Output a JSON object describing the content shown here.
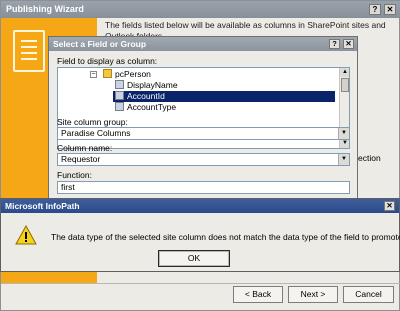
{
  "wizard": {
    "title": "Publishing Wizard",
    "intro": "The fields listed below will be available as columns in SharePoint sites and Outlook folders.",
    "behind_text": "ection",
    "back_label": "< Back",
    "next_label": "Next >",
    "cancel_label": "Cancel"
  },
  "select_dialog": {
    "title": "Select a Field or Group",
    "field_label": "Field to display as column:",
    "tree": [
      {
        "label": "pcPerson",
        "icon": "folder-icon",
        "selected": false
      },
      {
        "label": "DisplayName",
        "icon": "field-icon",
        "selected": false
      },
      {
        "label": "AccountId",
        "icon": "field-icon",
        "selected": true
      },
      {
        "label": "AccountType",
        "icon": "field-icon",
        "selected": false
      }
    ],
    "site_group_label": "Site column group:",
    "site_group_value": "Paradise Columns",
    "column_name_label": "Column name:",
    "column_name_value": "Requestor",
    "function_label": "Function:",
    "function_value": "first"
  },
  "message_dialog": {
    "title": "Microsoft InfoPath",
    "text": "The data type of the selected site column does not match the data type of the field to promote.",
    "ok_label": "OK",
    "icon": "warning-icon"
  },
  "colors": {
    "wizard_accent": "#f6a715",
    "selection": "#0a246a",
    "dialog_title": "#2a4a8c"
  }
}
